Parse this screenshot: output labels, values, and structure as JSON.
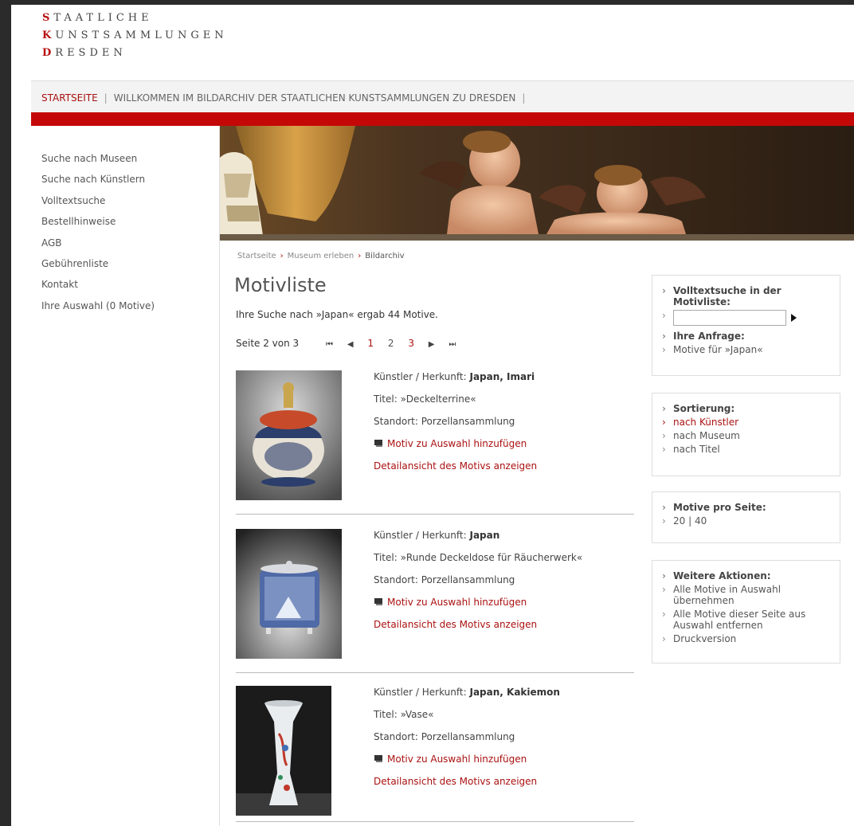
{
  "logo": {
    "line1_first": "S",
    "line1_rest": "TAATLICHE",
    "line2_first": "K",
    "line2_rest": "UNSTSAMMLUNGEN",
    "line3_first": "D",
    "line3_rest": "RESDEN"
  },
  "nav": {
    "home": "STARTSEITE",
    "welcome": "WILLKOMMEN IM BILDARCHIV DER STAATLICHEN KUNSTSAMMLUNGEN ZU DRESDEN"
  },
  "sidebar": {
    "items": [
      {
        "label": "Suche nach Museen"
      },
      {
        "label": "Suche nach Künstlern"
      },
      {
        "label": "Volltextsuche"
      },
      {
        "label": "Bestellhinweise"
      },
      {
        "label": "AGB"
      },
      {
        "label": "Gebührenliste"
      },
      {
        "label": "Kontakt"
      },
      {
        "label": "Ihre Auswahl (0 Motive)"
      }
    ]
  },
  "breadcrumb": {
    "items": [
      "Startseite",
      "Museum erleben",
      "Bildarchiv"
    ],
    "separator": "›"
  },
  "main": {
    "title": "Motivliste",
    "result_text": "Ihre Suche nach »Japan« ergab 44 Motive.",
    "page_label": "Seite 2 von 3",
    "pages": [
      "1",
      "2",
      "3"
    ],
    "current_page": "2"
  },
  "labels": {
    "artist": "Künstler / Herkunft:",
    "title": "Titel:",
    "location": "Standort:",
    "add_to_selection": "Motiv zu Auswahl hinzufügen",
    "detail_view": "Detailansicht des Motivs anzeigen"
  },
  "items": [
    {
      "artist": "Japan, Imari",
      "title": "»Deckelterrine«",
      "location": "Porzellansammlung"
    },
    {
      "artist": "Japan",
      "title": "»Runde Deckeldose für Räucherwerk«",
      "location": "Porzellansammlung"
    },
    {
      "artist": "Japan, Kakiemon",
      "title": "»Vase«",
      "location": "Porzellansammlung"
    }
  ],
  "right": {
    "search": {
      "head": "Volltextsuche in der Motivliste:",
      "input_value": "",
      "query_label": "Ihre Anfrage:",
      "query_value": "Motive für »Japan«"
    },
    "sort": {
      "head": "Sortierung:",
      "options": [
        "nach Künstler",
        "nach Museum",
        "nach Titel"
      ],
      "active": "nach Künstler"
    },
    "per_page": {
      "head": "Motive pro Seite:",
      "value": "20 | 40"
    },
    "actions": {
      "head": "Weitere Aktionen:",
      "items": [
        "Alle Motive in Auswahl übernehmen",
        "Alle Motive dieser Seite aus Auswahl entfernen",
        "Druckversion"
      ]
    }
  },
  "colors": {
    "accent": "#c40808",
    "link": "#aa1111"
  }
}
